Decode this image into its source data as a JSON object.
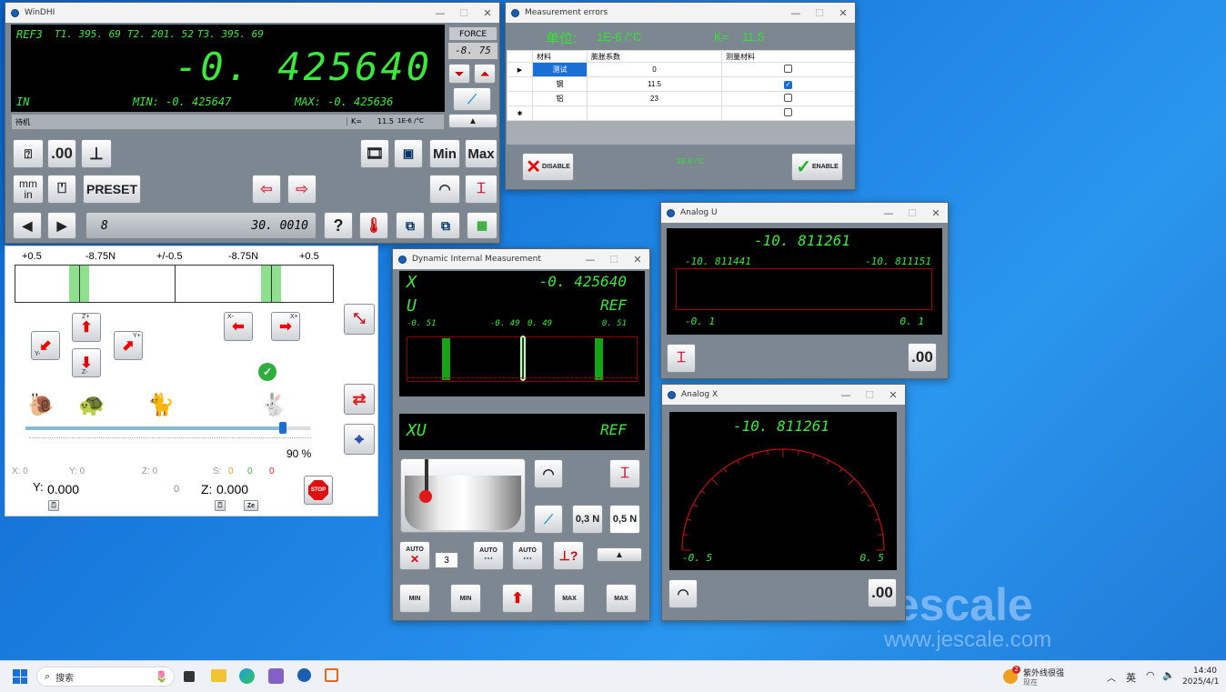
{
  "desktop": {
    "watermark_brand": "Jescale",
    "watermark_url": "www.jescale.com"
  },
  "windhi": {
    "title": "WinDHI",
    "ref": "REF3",
    "t1": "T1. 395. 69",
    "t2": "T2. 201. 52",
    "t3": "T3. 395. 69",
    "value": "-0. 425640",
    "unit": "IN",
    "min": "MIN: -0. 425647",
    "max": "MAX: -0. 425636",
    "force_label": "FORCE",
    "force_value": "-8. 75",
    "status": "待机",
    "k_label": "K=",
    "k_value": "11.5",
    "k_unit": "1E-6 /°C",
    "btn_00": ".00",
    "btn_min": "Min",
    "btn_max": "Max",
    "btn_mm": "mm",
    "btn_in": "in",
    "btn_preset": "PRESET",
    "channel": "8",
    "channel_value": "30. 0010",
    "btn_help": "?"
  },
  "probe_panel": {
    "labels": [
      "+0.5",
      "-8.75N",
      "+/-0.5",
      "-8.75N",
      "+0.5"
    ],
    "arrows": {
      "z_plus": "Z+",
      "z_minus": "Z-",
      "y_minus": "Y-",
      "y_plus": "Y+",
      "x_minus": "X-",
      "x_plus": "X+"
    },
    "speed_percent": "90 %",
    "speed_fraction": 0.9,
    "x_coord": "X: 0",
    "y_coord": "Y: 0",
    "z_coord": "Z: 0",
    "s_label": "S:",
    "s_vals": [
      "0",
      "0",
      "0"
    ],
    "y_value_label": "Y:",
    "y_value": "0.000",
    "mid_zero": "0",
    "z_value_label": "Z:",
    "z_value": "0.000",
    "ze_label": "Ze",
    "stop": "STOP"
  },
  "errors": {
    "title": "Measurement errors",
    "unit_label": "单位:",
    "unit_value": "1E-6 /°C",
    "k_label": "K=",
    "k_value": "11.5",
    "headers": [
      "材料",
      "膨胀系数",
      "测量材料"
    ],
    "rows": [
      {
        "mat": "测试",
        "coef": "0",
        "checked": false
      },
      {
        "mat": "钢",
        "coef": "11.5",
        "checked": true
      },
      {
        "mat": "铝",
        "coef": "23",
        "checked": false
      }
    ],
    "footer_unit": "1E-6 /°C",
    "disable": "DISABLE",
    "enable": "ENABLE"
  },
  "dim": {
    "title": "Dynamic Internal Measurement",
    "x_label": "X",
    "x_value": "-0. 425640",
    "u_label": "U",
    "ref_label": "REF",
    "scale": [
      "-0. 51",
      "-0. 49",
      "0. 49",
      "0. 51"
    ],
    "xu_label": "XU",
    "ref2": "REF",
    "btn_03n": "0,3 N",
    "btn_05n": "0,5 N",
    "auto": "AUTO",
    "auto_count": "3",
    "min": "MIN",
    "max": "MAX"
  },
  "analog_u": {
    "title": "Analog U",
    "value": "-10. 811261",
    "left": "-10. 811441",
    "right": "-10. 811151",
    "min": "-0. 1",
    "max": "0. 1",
    "btn_00": ".00"
  },
  "analog_x": {
    "title": "Analog X",
    "value": "-10. 811261",
    "min": "-0. 5",
    "max": "0. 5",
    "btn_00": ".00"
  },
  "taskbar": {
    "search": "搜索",
    "notif_title": "紫外线很强",
    "notif_sub": "现在",
    "notif_badge": "2",
    "lang": "英",
    "time": "14:40",
    "date": "2025/4/1"
  }
}
